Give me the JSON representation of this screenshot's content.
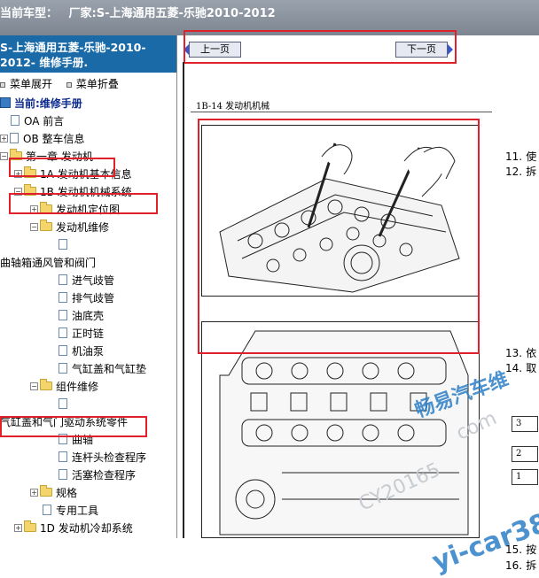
{
  "titlebar": {
    "label": "当前车型：",
    "factory": "厂家:S-上海通用五菱-乐驰2010-2012"
  },
  "book": {
    "line1": "S-上海通用五菱-乐驰-2010-",
    "line2": "2012- 维修手册."
  },
  "toolbar": {
    "expand": "菜单展开",
    "collapse": "菜单折叠"
  },
  "tree": {
    "root": "当前:维修手册",
    "items": [
      {
        "label": "OA 前言"
      },
      {
        "label": "OB 整车信息"
      },
      {
        "label": "第一章 发动机"
      },
      {
        "label": "1A 发动机基本信息"
      },
      {
        "label": "1B 发动机机械系统"
      },
      {
        "label": "发动机定位图"
      },
      {
        "label": "发动机维修"
      },
      {
        "label": ""
      },
      {
        "label": "曲轴箱通风管和阀门"
      },
      {
        "label": "进气歧管"
      },
      {
        "label": "排气歧管"
      },
      {
        "label": "油底壳"
      },
      {
        "label": "正时链"
      },
      {
        "label": "机油泵"
      },
      {
        "label": "气缸盖和气缸垫"
      },
      {
        "label": "组件维修"
      },
      {
        "label": ""
      },
      {
        "label": "气缸盖和气门驱动系统零件"
      },
      {
        "label": "曲轴"
      },
      {
        "label": "连杆头检查程序"
      },
      {
        "label": "活塞检查程序"
      },
      {
        "label": "规格"
      },
      {
        "label": "专用工具"
      },
      {
        "label": "1D 发动机冷却系统"
      }
    ]
  },
  "nav": {
    "prev": "上一页",
    "next": "下一页"
  },
  "page": {
    "header": "1B-14   发动机机械",
    "steps": [
      {
        "num": "11.",
        "text": "使"
      },
      {
        "num": "12.",
        "text": "拆"
      },
      {
        "num": "13.",
        "text": "依"
      },
      {
        "num": "14.",
        "text": "取"
      },
      {
        "num": "15.",
        "text": "按"
      },
      {
        "num": "16.",
        "text": "拆"
      }
    ],
    "boxes": [
      "3",
      "2",
      "1"
    ]
  },
  "watermarks": {
    "cn": "畅易汽车维",
    "url": "yi-car38",
    "com": "com",
    "cy": "CY20165"
  },
  "colors": {
    "highlight": "#e0202a",
    "header_blue": "#1a6aa8",
    "watermark_blue": "#2d7fc6"
  }
}
